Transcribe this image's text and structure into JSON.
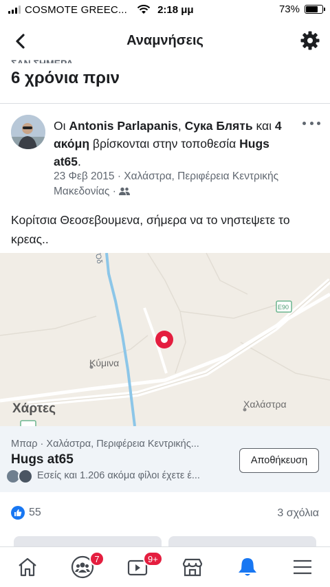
{
  "status_bar": {
    "carrier": "COSMOTE GREEC...",
    "time": "2:18 μμ",
    "battery": "73%",
    "battery_level": 0.73
  },
  "header": {
    "title": "Αναμνήσεις",
    "back_icon": "chevron-left-icon",
    "settings_icon": "gear-icon"
  },
  "section": {
    "clipped_label": "ΣΑΝ ΣΗΜΕΡΑ",
    "heading": "6 χρόνια πριν"
  },
  "post": {
    "text_prefix": "Οι ",
    "author": "Antonis Parlapanis",
    "separator": ", ",
    "tagged": "Сука Блять",
    "and": " και ",
    "others": "4 ακόμη",
    "location_text": " βρίσκονται στην τοποθεσία ",
    "place": "Hugs at65",
    "place_suffix": ".",
    "date_location": "23 Φεβ 2015 · Χαλάστρα, Περιφέρεια Κεντρικής Μακεδονίας ·",
    "privacy_icon": "friends-icon",
    "body": "Κορίτσια Θεοσεβουμενα, σήμερα να το νηστεψετε το κρεας.."
  },
  "map": {
    "labels": {
      "road": "Όδ",
      "kymina": "Κύμινα",
      "chalastra": "Χαλάστρα",
      "road_shield": "E90"
    },
    "logo": "Χάρτες"
  },
  "place_card": {
    "category": "Μπαρ · Χαλάστρα, Περιφέρεια Κεντρικής...",
    "name": "Hugs at65",
    "friends_text": "Εσείς και 1.206 ακόμα φίλοι έχετε έ...",
    "save_label": "Αποθήκευση"
  },
  "reactions": {
    "likes": "55",
    "comments": "3 σχόλια"
  },
  "bottom_nav": {
    "items": [
      {
        "icon": "home-icon"
      },
      {
        "icon": "groups-icon",
        "badge": "7"
      },
      {
        "icon": "watch-icon",
        "badge": "9+"
      },
      {
        "icon": "marketplace-icon"
      },
      {
        "icon": "bell-icon",
        "active": true
      },
      {
        "icon": "menu-icon"
      }
    ]
  },
  "colors": {
    "accent": "#1877f2",
    "badge": "#e41e3f",
    "map_pin": "#e41e3f"
  }
}
